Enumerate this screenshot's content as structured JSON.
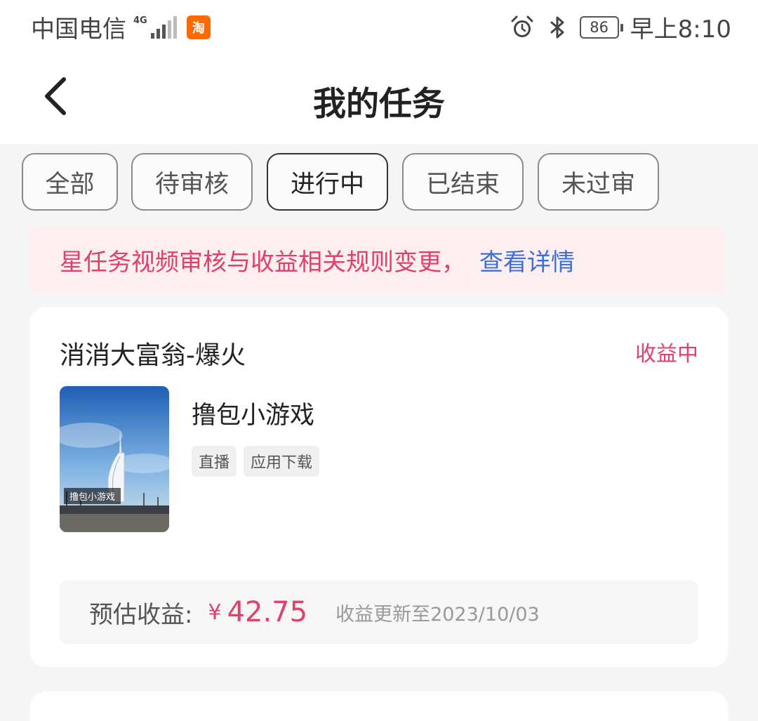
{
  "status_bar": {
    "carrier": "中国电信",
    "network": "4G",
    "app_badge": "淘",
    "battery": "86",
    "time": "早上8:10"
  },
  "header": {
    "title": "我的任务"
  },
  "tabs": [
    {
      "label": "全部"
    },
    {
      "label": "待审核"
    },
    {
      "label": "进行中"
    },
    {
      "label": "已结束"
    },
    {
      "label": "未过审"
    }
  ],
  "notice": {
    "text": "星任务视频审核与收益相关规则变更，",
    "link": "查看详情"
  },
  "cards": [
    {
      "title": "消消大富翁-爆火",
      "status": "收益中",
      "thumbnail_caption": "撸包小游戏",
      "game_name": "撸包小游戏",
      "tags": [
        "直播",
        "应用下载"
      ],
      "earnings_label": "预估收益:",
      "currency": "¥",
      "amount": "42.75",
      "update_text": "收益更新至2023/10/03"
    },
    {}
  ],
  "colors": {
    "accent": "#e0406a",
    "link": "#3d6fd8",
    "notice_bg": "#fdeeef"
  }
}
